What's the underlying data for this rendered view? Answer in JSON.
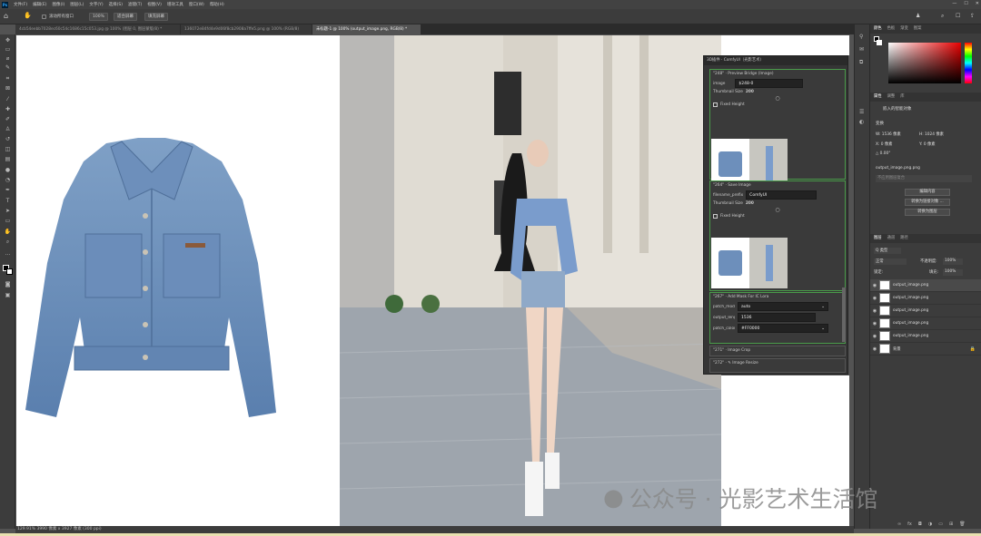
{
  "app": {
    "logo": "Ps"
  },
  "menu": [
    "文件(F)",
    "编辑(E)",
    "图像(I)",
    "图层(L)",
    "文字(Y)",
    "选择(S)",
    "滤镜(T)",
    "视图(V)",
    "增效工具",
    "窗口(W)",
    "帮助(H)"
  ],
  "window_controls": [
    "—",
    "☐",
    "✕"
  ],
  "options": {
    "scroll_all": "滚动所有窗口",
    "zoom": "100%",
    "fit": "适合屏幕",
    "fill": "填充屏幕"
  },
  "tabs": [
    "4cb54eebb7028ec60c54c1686c15c053.jpg @ 100% (图层 0, 图层蒙版/8) *",
    "136072e84fd4e9d06f8cb2908a7ffe5.png @ 100% (RGB/8)",
    "未标题-1 @ 100% (output_image.png, RGB/8) *"
  ],
  "status": "129.91%  3990 像素 x 3927 像素 (300 ppi)",
  "comfy": {
    "header": "3D插件 · ComfyUI（光影艺术）",
    "n1": {
      "title": "\"248\" · Preview Bridge (Image)",
      "image_label": "image",
      "image_val": "$248-0",
      "thumb": "Thumbnail Size",
      "thumb_val": "200",
      "fixed": "Fixed Height"
    },
    "n2": {
      "title": "\"264\" · Save Image",
      "prefix_label": "filename_prefix",
      "prefix_val": "ComfyUI",
      "thumb": "Thumbnail Size",
      "thumb_val": "200",
      "fixed": "Fixed Height"
    },
    "n3": {
      "title": "\"267\" · Add Mask For IC Lora",
      "mode_label": "patch_mode",
      "mode_val": "auto",
      "len_label": "output_length",
      "len_val": "1536",
      "color_label": "patch_color",
      "color_val": "#FF0000"
    },
    "n4": {
      "title": "\"271\" · Image Crop"
    },
    "n5": {
      "title": "\"272\" · ✎ Image Resize"
    }
  },
  "panel": {
    "color_tabs": [
      "颜色",
      "色板",
      "渐变",
      "图案"
    ],
    "prop_tabs": [
      "属性",
      "调整",
      "库"
    ],
    "prop_kind": "嵌入的智能对象",
    "transform": "变换",
    "w": "W:  1536 像素",
    "h": "H:  1024 像素",
    "x": "X:  0 像素",
    "y": "Y:  0 像素",
    "angle": "△  0.00°",
    "file": "output_image.png.png",
    "layer_comp": "不应用图层复合",
    "edit_btn": "编辑内容",
    "convert_btn": "转换为链接对象 ...",
    "convert_layer_btn": "转换为图层",
    "layer_tabs": [
      "图层",
      "通道",
      "路径"
    ],
    "filter_kind": "Q 类型",
    "blend": "正常",
    "opacity_label": "不透明度:",
    "opacity": "100%",
    "lock": "锁定:",
    "fill_label": "填充:",
    "fill": "100%",
    "layers": [
      "output_image.png",
      "output_image.png",
      "output_image.png",
      "output_image.png",
      "output_image.png",
      "背景"
    ]
  },
  "watermark": "公众号 · 光影艺术生活馆"
}
